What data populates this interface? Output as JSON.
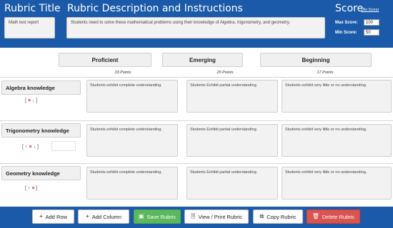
{
  "header": {
    "title_label": "Rubric Title",
    "title_value": "Math test report",
    "desc_label": "Rubric Description and Instructions",
    "desc_value": "Students need to solve these mathematical problems using their knowledge of Algebra, trigonometry, and geometry.",
    "score_label": "Score",
    "no_score_link": "(No Score)",
    "max_label": "Max Score:",
    "max_value": "100",
    "min_label": "Min Score:",
    "min_value": "50"
  },
  "levels": [
    {
      "name": "Proficient",
      "points": "33 Points"
    },
    {
      "name": "Emerging",
      "points": "25 Points"
    },
    {
      "name": "Beginning",
      "points": "17 Points"
    }
  ],
  "criteria": [
    {
      "name": "Algebra knowledge",
      "cells": [
        "Students exhibit complete understanding.",
        "Students Exhibit partial understanding.",
        "Students exhibit very little or no understanding."
      ]
    },
    {
      "name": "Trigonometry knowledge",
      "cells": [
        "Students exhibit complete understanding.",
        "Students Exhibit partial understanding.",
        "Students exhibit very little or no understanding."
      ]
    },
    {
      "name": "Geometry knowledge",
      "cells": [
        "Students exhibit complete understanding.",
        "Students Exhibit partial understanding.",
        "Students exhibit very little or no understanding."
      ]
    }
  ],
  "controls": {
    "open_bracket": "[",
    "close_bracket": "]",
    "up_arrow": "↑",
    "remove": "×",
    "down_arrow": "↓"
  },
  "footer": {
    "add_row": "Add Row",
    "add_column": "Add Column",
    "save": "Save Rubric",
    "view_print": "View / Print Rubric",
    "copy": "Copy Rubric",
    "delete": "Delete Rubric"
  },
  "colors": {
    "header_bg": "#1a5aa8",
    "save_green": "#5cb85c",
    "delete_red": "#d9534f"
  }
}
